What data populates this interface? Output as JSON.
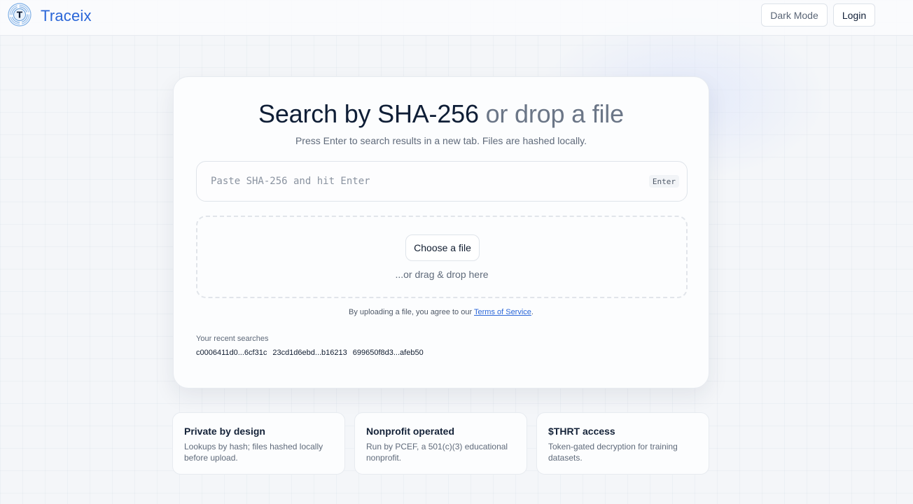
{
  "header": {
    "brand": "Traceix",
    "logo_letter": "T",
    "dark_mode_label": "Dark Mode",
    "login_label": "Login"
  },
  "hero": {
    "title_main": "Search by SHA-256",
    "title_muted": " or drop a file",
    "subtitle": "Press Enter to search results in a new tab. Files are hashed locally."
  },
  "search": {
    "placeholder": "Paste SHA-256 and hit Enter",
    "value": "",
    "enter_badge": "Enter"
  },
  "upload": {
    "choose_label": "Choose a file",
    "drag_text": "...or drag & drop here",
    "tos_prefix": "By uploading a file, you agree to our ",
    "tos_link": "Terms of Service",
    "tos_suffix": "."
  },
  "recent": {
    "label": "Your recent searches",
    "items": [
      "c0006411d0...6cf31c",
      "23cd1d6ebd...b16213",
      "699650f8d3...afeb50"
    ]
  },
  "features": [
    {
      "title": "Private by design",
      "text": "Lookups by hash; files hashed locally before upload."
    },
    {
      "title": "Nonprofit operated",
      "text": "Run by PCEF, a 501(c)(3) educational nonprofit."
    },
    {
      "title": "$THRT access",
      "text": "Token-gated decryption for training datasets."
    }
  ],
  "colors": {
    "brand": "#2a66d8",
    "title": "#0f1e36",
    "muted": "#6b7687"
  }
}
